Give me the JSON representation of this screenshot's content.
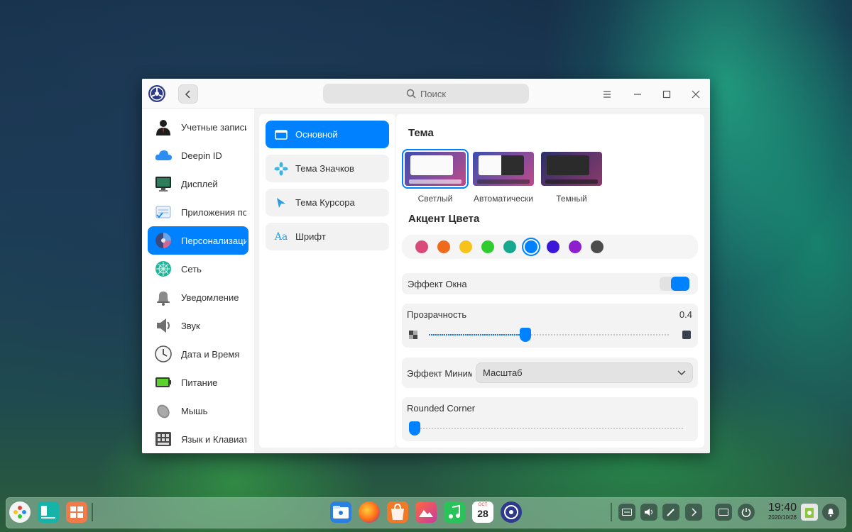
{
  "window": {
    "search_placeholder": "Поиск",
    "buttons": [
      "menu",
      "minimize",
      "maximize",
      "close"
    ]
  },
  "sidebar": {
    "items": [
      {
        "label": "Учетные записи",
        "icon": "user-account-icon"
      },
      {
        "label": "Deepin ID",
        "icon": "cloud-icon"
      },
      {
        "label": "Дисплей",
        "icon": "display-icon"
      },
      {
        "label": "Приложения по умолчанию",
        "icon": "default-apps-icon"
      },
      {
        "label": "Персонализация",
        "icon": "personalization-icon",
        "active": true
      },
      {
        "label": "Сеть",
        "icon": "network-icon"
      },
      {
        "label": "Уведомление",
        "icon": "bell-icon"
      },
      {
        "label": "Звук",
        "icon": "speaker-icon"
      },
      {
        "label": "Дата и Время",
        "icon": "clock-icon"
      },
      {
        "label": "Питание",
        "icon": "battery-icon"
      },
      {
        "label": "Мышь",
        "icon": "mouse-icon"
      },
      {
        "label": "Язык и Клавиатура",
        "icon": "keyboard-icon"
      }
    ]
  },
  "subnav": {
    "items": [
      {
        "label": "Основной",
        "active": true
      },
      {
        "label": "Тема Значков"
      },
      {
        "label": "Тема Курсора"
      },
      {
        "label": "Шрифт"
      }
    ]
  },
  "content": {
    "theme_title": "Тема",
    "themes": [
      {
        "label": "Светлый",
        "selected": true
      },
      {
        "label": "Автоматически"
      },
      {
        "label": "Темный"
      }
    ],
    "accent_title": "Акцент Цвета",
    "accent_colors": [
      "#d94a7a",
      "#f06a1c",
      "#f7c21a",
      "#2fcc2f",
      "#17a98f",
      "#0081ff",
      "#3c17d9",
      "#8e1fcf",
      "#4d4d4d"
    ],
    "accent_selected_index": 5,
    "window_effect": {
      "label": "Эффект Окна",
      "enabled": true
    },
    "transparency": {
      "label": "Прозрачность",
      "value": "0.4",
      "fraction": 0.4
    },
    "minimize_effect": {
      "label": "Эффект Минимизации",
      "value": "Масштаб"
    },
    "rounded_corner": {
      "label": "Rounded Corner",
      "fraction": 0.0
    }
  },
  "dock": {
    "apps": [
      "launcher-icon",
      "multitask-icon",
      "app-store-icon",
      "file-manager-icon",
      "firefox-icon",
      "deepin-store-icon",
      "image-viewer-icon",
      "music-icon",
      "calendar-icon",
      "control-center-icon"
    ],
    "calendar": {
      "month": "OCT",
      "day": "28"
    },
    "clock": {
      "time": "19:40",
      "date": "2020/10/28"
    }
  }
}
